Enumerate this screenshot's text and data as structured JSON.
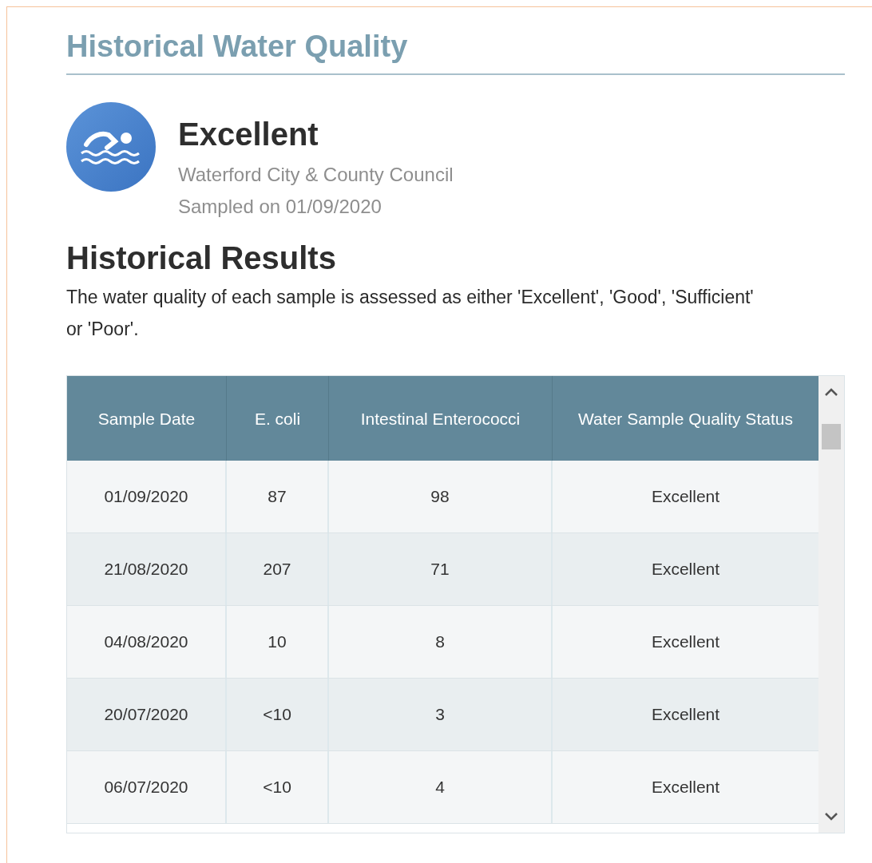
{
  "title": "Historical Water Quality",
  "rating": {
    "label": "Excellent",
    "council": "Waterford City & County Council",
    "sampled": "Sampled on 01/09/2020"
  },
  "section": {
    "heading": "Historical Results",
    "description": "The water quality of each sample is assessed as either 'Excellent', 'Good', 'Sufficient' or 'Poor'."
  },
  "table": {
    "columns": [
      "Sample Date",
      "E. coli",
      "Intestinal Enterococci",
      "Water Sample Quality Status"
    ],
    "rows": [
      {
        "cells": [
          "01/09/2020",
          "87",
          "98",
          "Excellent"
        ]
      },
      {
        "cells": [
          "21/08/2020",
          "207",
          "71",
          "Excellent"
        ]
      },
      {
        "cells": [
          "04/08/2020",
          "10",
          "8",
          "Excellent"
        ]
      },
      {
        "cells": [
          "20/07/2020",
          "<10",
          "3",
          "Excellent"
        ]
      },
      {
        "cells": [
          "06/07/2020",
          "<10",
          "4",
          "Excellent"
        ]
      }
    ]
  }
}
